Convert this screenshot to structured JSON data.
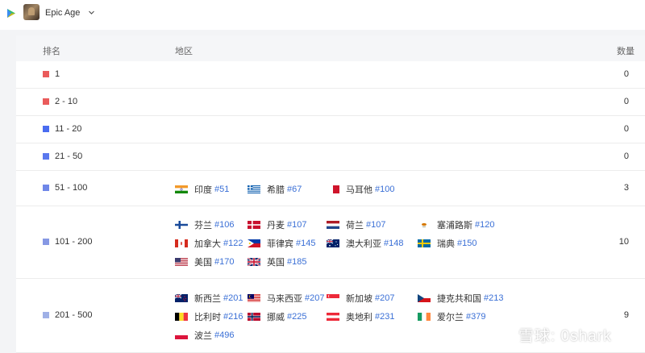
{
  "header": {
    "app_name": "Epic Age"
  },
  "table": {
    "columns": {
      "rank": "排名",
      "region": "地区",
      "count": "数量"
    },
    "rows": [
      {
        "rank": "1",
        "color": "#ea5b5b",
        "count": "0",
        "entries": []
      },
      {
        "rank": "2 - 10",
        "color": "#ea5b5b",
        "count": "0",
        "entries": []
      },
      {
        "rank": "11 - 20",
        "color": "#4a6cf0",
        "count": "0",
        "entries": []
      },
      {
        "rank": "21 - 50",
        "color": "#5a78ee",
        "count": "0",
        "entries": []
      },
      {
        "rank": "51 - 100",
        "color": "#6f87e8",
        "count": "3",
        "entries": [
          {
            "flag": "india",
            "name": "印度",
            "rank": "#51"
          },
          {
            "flag": "greece",
            "name": "希腊",
            "rank": "#67"
          },
          {
            "flag": "malta",
            "name": "马耳他",
            "rank": "#100"
          }
        ]
      },
      {
        "rank": "101 - 200",
        "color": "#8698e4",
        "count": "10",
        "entries": [
          {
            "flag": "finland",
            "name": "芬兰",
            "rank": "#106"
          },
          {
            "flag": "denmark",
            "name": "丹麦",
            "rank": "#107"
          },
          {
            "flag": "netherlands",
            "name": "荷兰",
            "rank": "#107"
          },
          {
            "flag": "cyprus",
            "name": "塞浦路斯",
            "rank": "#120"
          },
          {
            "flag": "canada",
            "name": "加拿大",
            "rank": "#122"
          },
          {
            "flag": "philippines",
            "name": "菲律宾",
            "rank": "#145"
          },
          {
            "flag": "australia",
            "name": "澳大利亚",
            "rank": "#148"
          },
          {
            "flag": "sweden",
            "name": "瑞典",
            "rank": "#150"
          },
          {
            "flag": "usa",
            "name": "美国",
            "rank": "#170"
          },
          {
            "flag": "uk",
            "name": "英国",
            "rank": "#185"
          }
        ]
      },
      {
        "rank": "201 - 500",
        "color": "#9fb0e6",
        "count": "9",
        "entries": [
          {
            "flag": "new-zealand",
            "name": "新西兰",
            "rank": "#201"
          },
          {
            "flag": "malaysia",
            "name": "马来西亚",
            "rank": "#207"
          },
          {
            "flag": "singapore",
            "name": "新加坡",
            "rank": "#207"
          },
          {
            "flag": "czech",
            "name": "捷克共和国",
            "rank": "#213"
          },
          {
            "flag": "belgium",
            "name": "比利时",
            "rank": "#216"
          },
          {
            "flag": "norway",
            "name": "挪威",
            "rank": "#225"
          },
          {
            "flag": "austria",
            "name": "奥地利",
            "rank": "#231"
          },
          {
            "flag": "ireland",
            "name": "爱尔兰",
            "rank": "#379"
          },
          {
            "flag": "poland",
            "name": "波兰",
            "rank": "#496"
          }
        ]
      }
    ]
  },
  "watermark": {
    "text": "雪球: 0shark"
  }
}
